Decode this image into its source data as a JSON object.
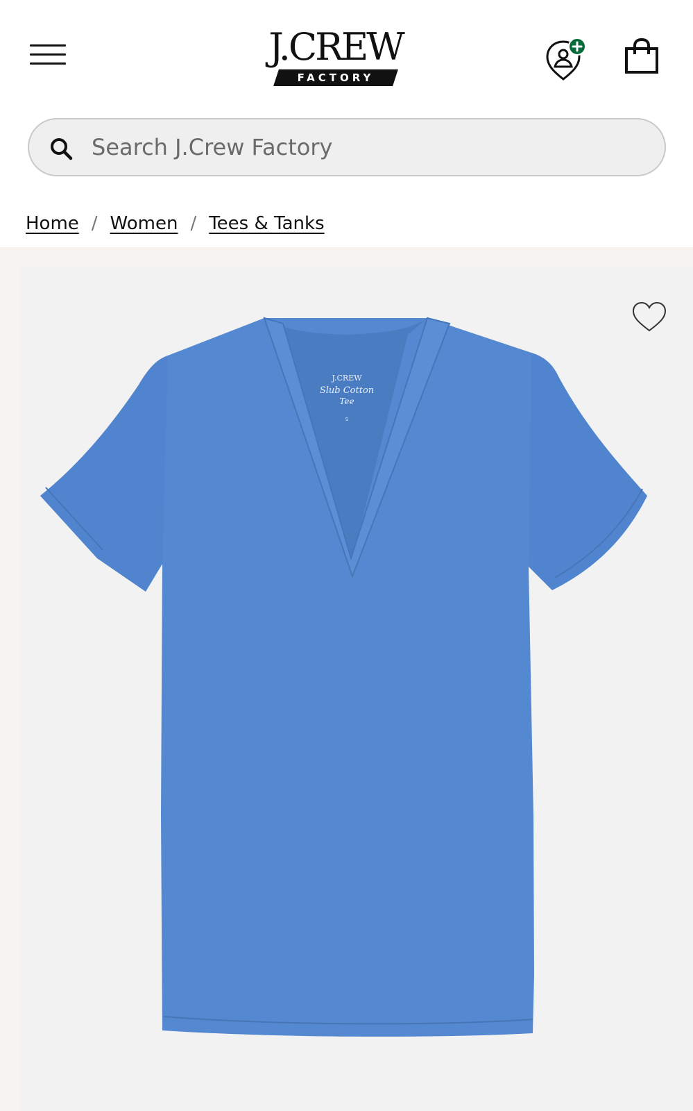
{
  "header": {
    "menu_label": "Menu",
    "logo_text": "J.CREW",
    "logo_subtext": "FACTORY",
    "rewards_icon": "rewards-plus-icon",
    "bag_icon": "shopping-bag-icon"
  },
  "search": {
    "placeholder": "Search J.Crew Factory",
    "value": ""
  },
  "breadcrumb": {
    "items": [
      "Home",
      "Women",
      "Tees & Tanks"
    ],
    "separator": "/"
  },
  "product": {
    "tag_brand": "J.CREW",
    "tag_style": "Slub Cotton",
    "tag_style2": "Tee",
    "tag_size": "S",
    "shirt_color": "#5488d1",
    "wishlist_icon": "heart-outline-icon"
  },
  "colors": {
    "rewards_accent": "#0a6b3a",
    "brand_black": "#111111"
  }
}
